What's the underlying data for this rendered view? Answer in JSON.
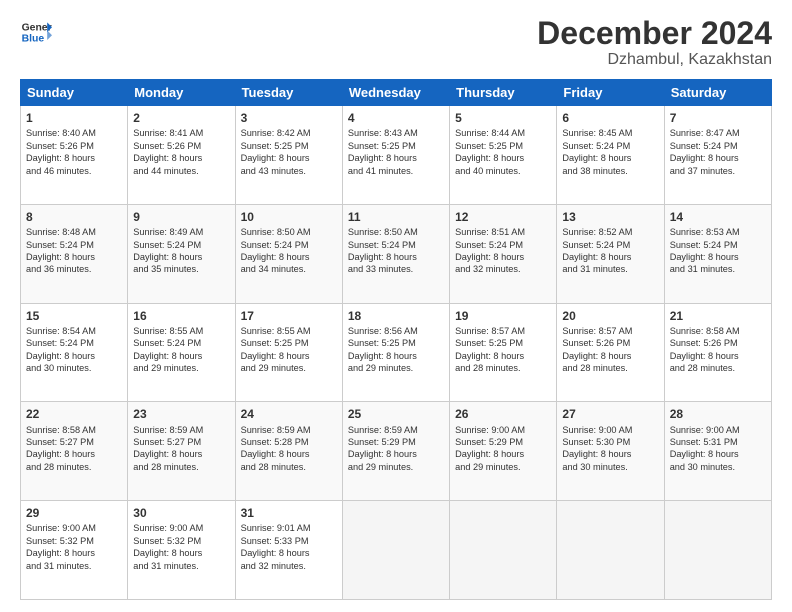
{
  "header": {
    "logo_line1": "General",
    "logo_line2": "Blue",
    "title": "December 2024",
    "subtitle": "Dzhambul, Kazakhstan"
  },
  "weekdays": [
    "Sunday",
    "Monday",
    "Tuesday",
    "Wednesday",
    "Thursday",
    "Friday",
    "Saturday"
  ],
  "weeks": [
    [
      {
        "day": "1",
        "lines": [
          "Sunrise: 8:40 AM",
          "Sunset: 5:26 PM",
          "Daylight: 8 hours",
          "and 46 minutes."
        ]
      },
      {
        "day": "2",
        "lines": [
          "Sunrise: 8:41 AM",
          "Sunset: 5:26 PM",
          "Daylight: 8 hours",
          "and 44 minutes."
        ]
      },
      {
        "day": "3",
        "lines": [
          "Sunrise: 8:42 AM",
          "Sunset: 5:25 PM",
          "Daylight: 8 hours",
          "and 43 minutes."
        ]
      },
      {
        "day": "4",
        "lines": [
          "Sunrise: 8:43 AM",
          "Sunset: 5:25 PM",
          "Daylight: 8 hours",
          "and 41 minutes."
        ]
      },
      {
        "day": "5",
        "lines": [
          "Sunrise: 8:44 AM",
          "Sunset: 5:25 PM",
          "Daylight: 8 hours",
          "and 40 minutes."
        ]
      },
      {
        "day": "6",
        "lines": [
          "Sunrise: 8:45 AM",
          "Sunset: 5:24 PM",
          "Daylight: 8 hours",
          "and 38 minutes."
        ]
      },
      {
        "day": "7",
        "lines": [
          "Sunrise: 8:47 AM",
          "Sunset: 5:24 PM",
          "Daylight: 8 hours",
          "and 37 minutes."
        ]
      }
    ],
    [
      {
        "day": "8",
        "lines": [
          "Sunrise: 8:48 AM",
          "Sunset: 5:24 PM",
          "Daylight: 8 hours",
          "and 36 minutes."
        ]
      },
      {
        "day": "9",
        "lines": [
          "Sunrise: 8:49 AM",
          "Sunset: 5:24 PM",
          "Daylight: 8 hours",
          "and 35 minutes."
        ]
      },
      {
        "day": "10",
        "lines": [
          "Sunrise: 8:50 AM",
          "Sunset: 5:24 PM",
          "Daylight: 8 hours",
          "and 34 minutes."
        ]
      },
      {
        "day": "11",
        "lines": [
          "Sunrise: 8:50 AM",
          "Sunset: 5:24 PM",
          "Daylight: 8 hours",
          "and 33 minutes."
        ]
      },
      {
        "day": "12",
        "lines": [
          "Sunrise: 8:51 AM",
          "Sunset: 5:24 PM",
          "Daylight: 8 hours",
          "and 32 minutes."
        ]
      },
      {
        "day": "13",
        "lines": [
          "Sunrise: 8:52 AM",
          "Sunset: 5:24 PM",
          "Daylight: 8 hours",
          "and 31 minutes."
        ]
      },
      {
        "day": "14",
        "lines": [
          "Sunrise: 8:53 AM",
          "Sunset: 5:24 PM",
          "Daylight: 8 hours",
          "and 31 minutes."
        ]
      }
    ],
    [
      {
        "day": "15",
        "lines": [
          "Sunrise: 8:54 AM",
          "Sunset: 5:24 PM",
          "Daylight: 8 hours",
          "and 30 minutes."
        ]
      },
      {
        "day": "16",
        "lines": [
          "Sunrise: 8:55 AM",
          "Sunset: 5:24 PM",
          "Daylight: 8 hours",
          "and 29 minutes."
        ]
      },
      {
        "day": "17",
        "lines": [
          "Sunrise: 8:55 AM",
          "Sunset: 5:25 PM",
          "Daylight: 8 hours",
          "and 29 minutes."
        ]
      },
      {
        "day": "18",
        "lines": [
          "Sunrise: 8:56 AM",
          "Sunset: 5:25 PM",
          "Daylight: 8 hours",
          "and 29 minutes."
        ]
      },
      {
        "day": "19",
        "lines": [
          "Sunrise: 8:57 AM",
          "Sunset: 5:25 PM",
          "Daylight: 8 hours",
          "and 28 minutes."
        ]
      },
      {
        "day": "20",
        "lines": [
          "Sunrise: 8:57 AM",
          "Sunset: 5:26 PM",
          "Daylight: 8 hours",
          "and 28 minutes."
        ]
      },
      {
        "day": "21",
        "lines": [
          "Sunrise: 8:58 AM",
          "Sunset: 5:26 PM",
          "Daylight: 8 hours",
          "and 28 minutes."
        ]
      }
    ],
    [
      {
        "day": "22",
        "lines": [
          "Sunrise: 8:58 AM",
          "Sunset: 5:27 PM",
          "Daylight: 8 hours",
          "and 28 minutes."
        ]
      },
      {
        "day": "23",
        "lines": [
          "Sunrise: 8:59 AM",
          "Sunset: 5:27 PM",
          "Daylight: 8 hours",
          "and 28 minutes."
        ]
      },
      {
        "day": "24",
        "lines": [
          "Sunrise: 8:59 AM",
          "Sunset: 5:28 PM",
          "Daylight: 8 hours",
          "and 28 minutes."
        ]
      },
      {
        "day": "25",
        "lines": [
          "Sunrise: 8:59 AM",
          "Sunset: 5:29 PM",
          "Daylight: 8 hours",
          "and 29 minutes."
        ]
      },
      {
        "day": "26",
        "lines": [
          "Sunrise: 9:00 AM",
          "Sunset: 5:29 PM",
          "Daylight: 8 hours",
          "and 29 minutes."
        ]
      },
      {
        "day": "27",
        "lines": [
          "Sunrise: 9:00 AM",
          "Sunset: 5:30 PM",
          "Daylight: 8 hours",
          "and 30 minutes."
        ]
      },
      {
        "day": "28",
        "lines": [
          "Sunrise: 9:00 AM",
          "Sunset: 5:31 PM",
          "Daylight: 8 hours",
          "and 30 minutes."
        ]
      }
    ],
    [
      {
        "day": "29",
        "lines": [
          "Sunrise: 9:00 AM",
          "Sunset: 5:32 PM",
          "Daylight: 8 hours",
          "and 31 minutes."
        ]
      },
      {
        "day": "30",
        "lines": [
          "Sunrise: 9:00 AM",
          "Sunset: 5:32 PM",
          "Daylight: 8 hours",
          "and 31 minutes."
        ]
      },
      {
        "day": "31",
        "lines": [
          "Sunrise: 9:01 AM",
          "Sunset: 5:33 PM",
          "Daylight: 8 hours",
          "and 32 minutes."
        ]
      },
      null,
      null,
      null,
      null
    ]
  ]
}
